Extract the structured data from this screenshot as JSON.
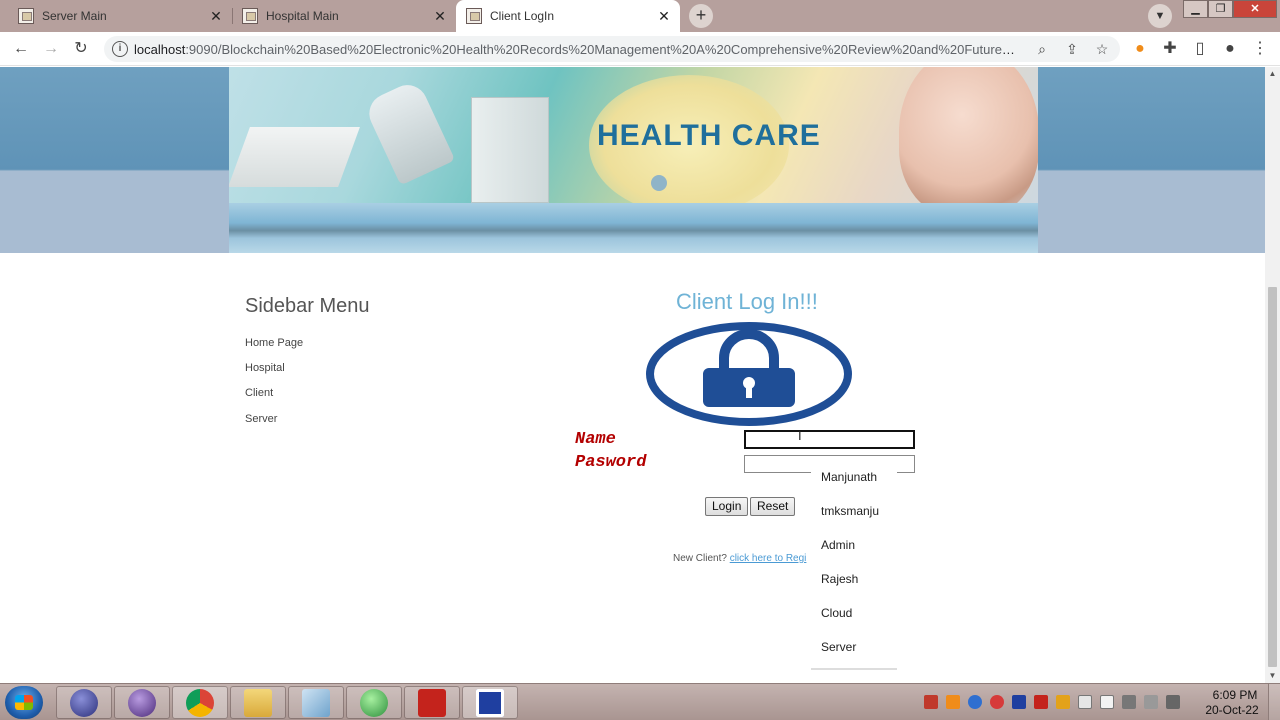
{
  "browser": {
    "tabs": [
      {
        "title": "Server Main"
      },
      {
        "title": "Hospital Main"
      },
      {
        "title": "Client LogIn"
      }
    ],
    "url_host": "localhost",
    "url_rest": ":9090/Blockchain%20Based%20Electronic%20Health%20Records%20Management%20A%20Comprehensive%20Review%20and%20Future%20R...",
    "icons": [
      "back-arrow-icon",
      "forward-arrow-icon",
      "reload-icon",
      "site-info-icon",
      "zoom-icon",
      "share-icon",
      "bookmark-star-icon",
      "extension-icon",
      "puzzle-icon",
      "side-panel-icon",
      "profile-icon",
      "menu-icon"
    ]
  },
  "banner": {
    "title": "HEALTH CARE"
  },
  "sidebar": {
    "heading": "Sidebar Menu",
    "items": [
      {
        "label": "Home Page"
      },
      {
        "label": "Hospital"
      },
      {
        "label": "Client"
      },
      {
        "label": "Server"
      }
    ]
  },
  "login_form": {
    "title": "Client Log In!!!",
    "name_label": "Name",
    "password_label": "Pasword",
    "name_value": "",
    "login_label": "Login",
    "reset_label": "Reset",
    "new_client_prefix": "New Client?",
    "register_link": "click here to Regi"
  },
  "autofill": {
    "suggestions": [
      "Manjunath",
      "tmksmanju",
      "Admin",
      "Rajesh",
      "Cloud",
      "Server"
    ]
  },
  "taskbar": {
    "time": "6:09 PM",
    "date": "20-Oct-22"
  },
  "colors": {
    "form_title": "#6fb3d6",
    "field_labels": "#b30000",
    "lock_blue": "#1f4e96",
    "header_band": "#5f93b7",
    "link": "#4a9ad4"
  }
}
